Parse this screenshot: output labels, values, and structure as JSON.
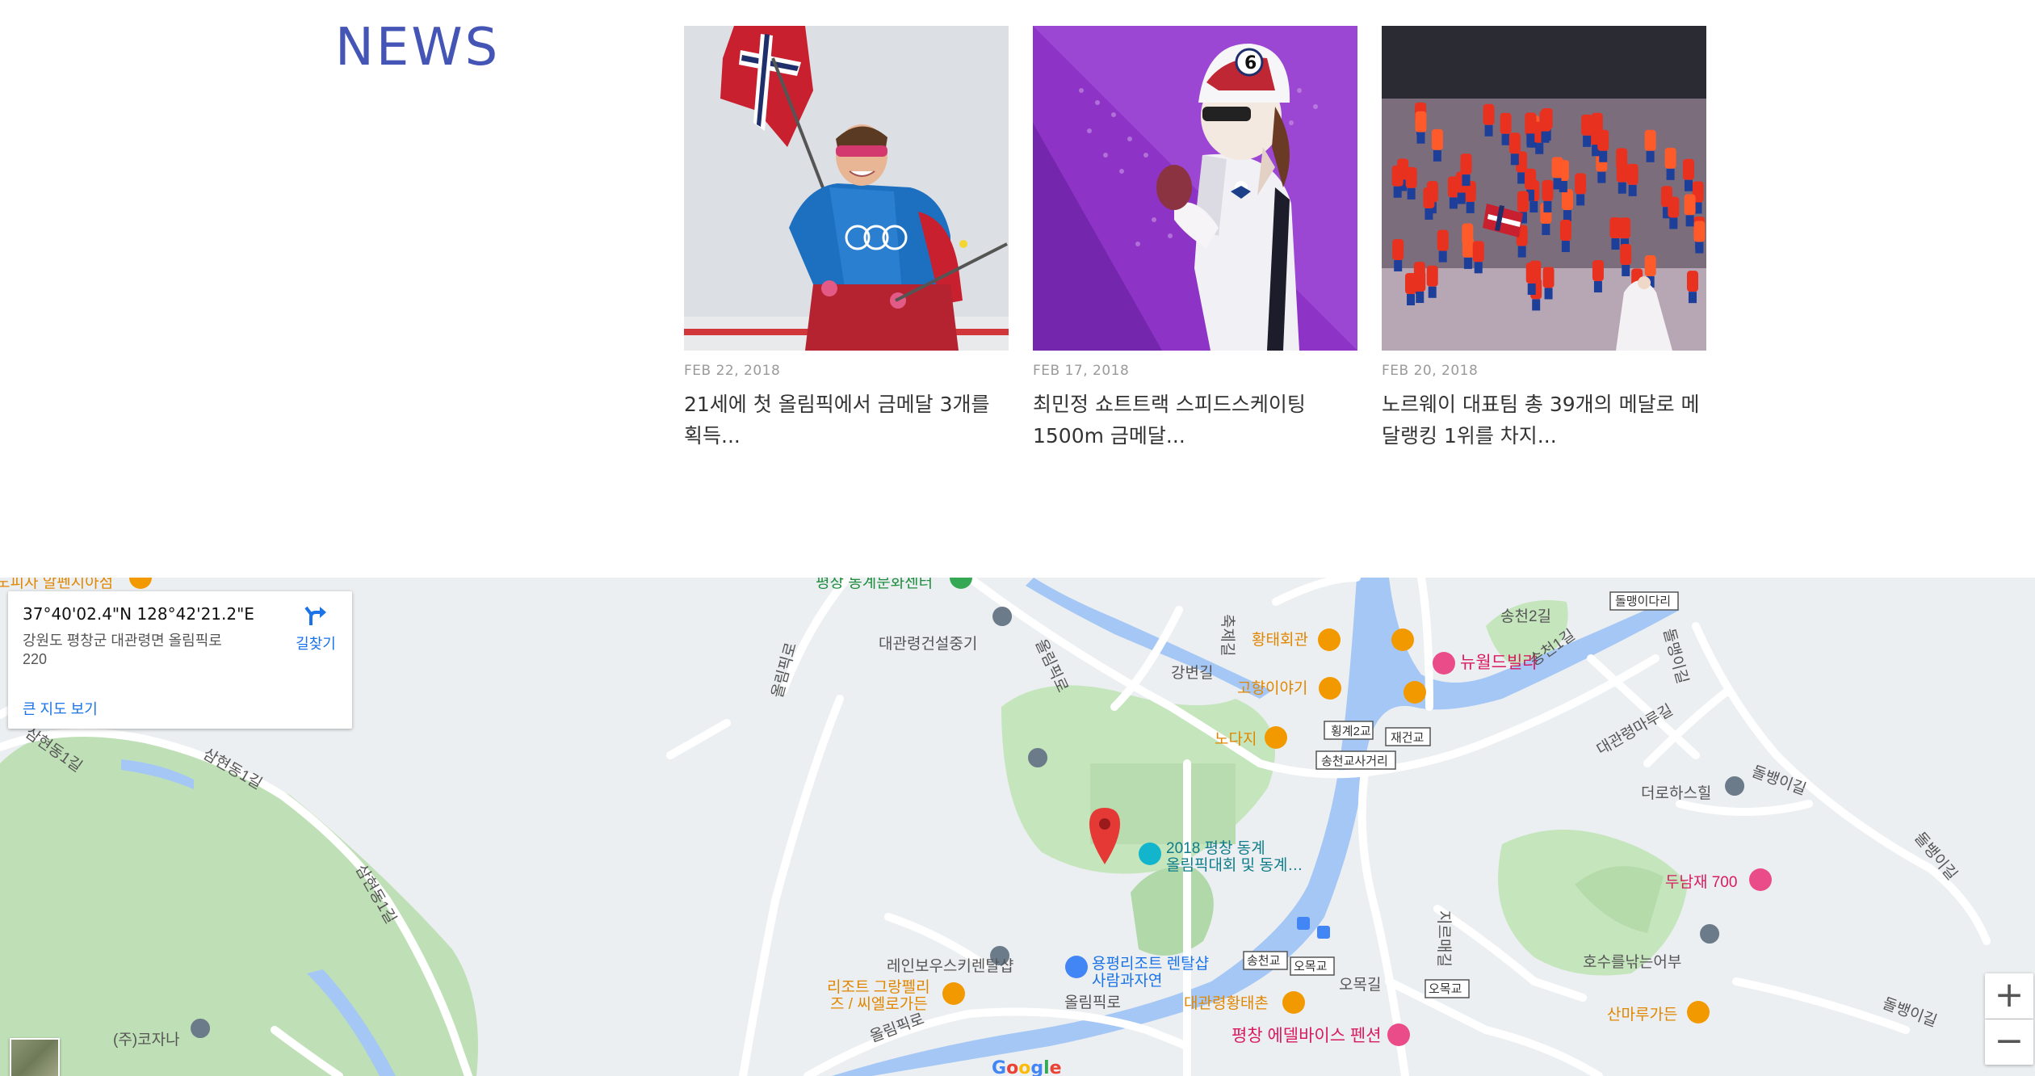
{
  "news": {
    "title": "NEWS",
    "cards": [
      {
        "date": "FEB 22, 2018",
        "headline_line1": "21세에 첫 올림픽에서 금메달 3개를",
        "headline_line2": "획득..."
      },
      {
        "date": "FEB 17, 2018",
        "headline_line1": "최민정 쇼트트랙 스피드스케이팅",
        "headline_line2": "1500m 금메달..."
      },
      {
        "date": "FEB 20, 2018",
        "headline_line1": "노르웨이 대표팀 총 39개의 메달로 메",
        "headline_line2": "달랭킹 1위를 차지..."
      }
    ]
  },
  "map": {
    "info": {
      "coords": "37°40'02.4\"N 128°42'21.2\"E",
      "address_line1": "강원도 평창군 대관령면 올림픽로",
      "address_line2": "220",
      "directions": "길찾기",
      "bigger_map": "큰 지도 보기"
    },
    "zoom_in": "+",
    "zoom_out": "−",
    "google": [
      "G",
      "o",
      "o",
      "g",
      "l",
      "e"
    ],
    "google_colors": [
      "#4285f4",
      "#ea4335",
      "#fbbc05",
      "#4285f4",
      "#34a853",
      "#ea4335"
    ],
    "labels": {
      "top_partial_left": "노피자 알펜시아점",
      "top_partial_center": "평창 동계문화센터",
      "daegwallyeong_const": "대관령건설중기",
      "olympic_ro_1": "올림픽로",
      "olympic_ro_2": "올림픽로",
      "olympic_ro_3": "올림픽로",
      "olympic_ro_4": "올림픽로",
      "gangbyeon": "강변길",
      "chukje": "축제길",
      "hwangtae": "황태회관",
      "gohyang": "고향이야기",
      "noda": "노다지",
      "hoenggye2": "횡계2교",
      "jaegeon": "재건교",
      "songcheon_int": "송천교사거리",
      "songcheon2": "송천2길",
      "songcheon1": "송천1길",
      "dolmaeng_bridge": "돌맹이다리",
      "dolmaeng_1": "돌맹이길",
      "dolmaeng_2": "돌뱅이길",
      "dolmaeng_3": "돌뱅이길",
      "dolmaeng_4": "돌뱅이길",
      "newworld": "뉴월드빌라",
      "daegwallyeong_maru": "대관령마루길",
      "thorhouse": "더로하스힐",
      "dunamjae": "두남재 700",
      "pyeongchang_museum_1": "2018 평창 동계",
      "pyeongchang_museum_2": "올림픽대회 및 동계…",
      "samhyeon1": "삼현동1길",
      "samhyeon2": "삼현동1길",
      "samhyeon3": "삼현동1길",
      "rainbow": "레인보우스키렌탈샵",
      "resort1": "리조트 그랑펠리",
      "resort2": "즈 / 씨엘로가든",
      "yongpyong1": "용평리조트 렌탈샵",
      "yongpyong2": "사람과자연",
      "songcheongyo": "송천교",
      "ogmokgyo1": "오목교",
      "ogmokgyo2": "오목교",
      "ogmokgil": "오목길",
      "jirumae": "지르매길",
      "hwangtaechon": "대관령황태촌",
      "edelweiss": "평창 에델바이스 펜션",
      "hosu": "호수를낚는어부",
      "sanmaru": "산마루가든",
      "kojana": "(주)코자나"
    }
  }
}
